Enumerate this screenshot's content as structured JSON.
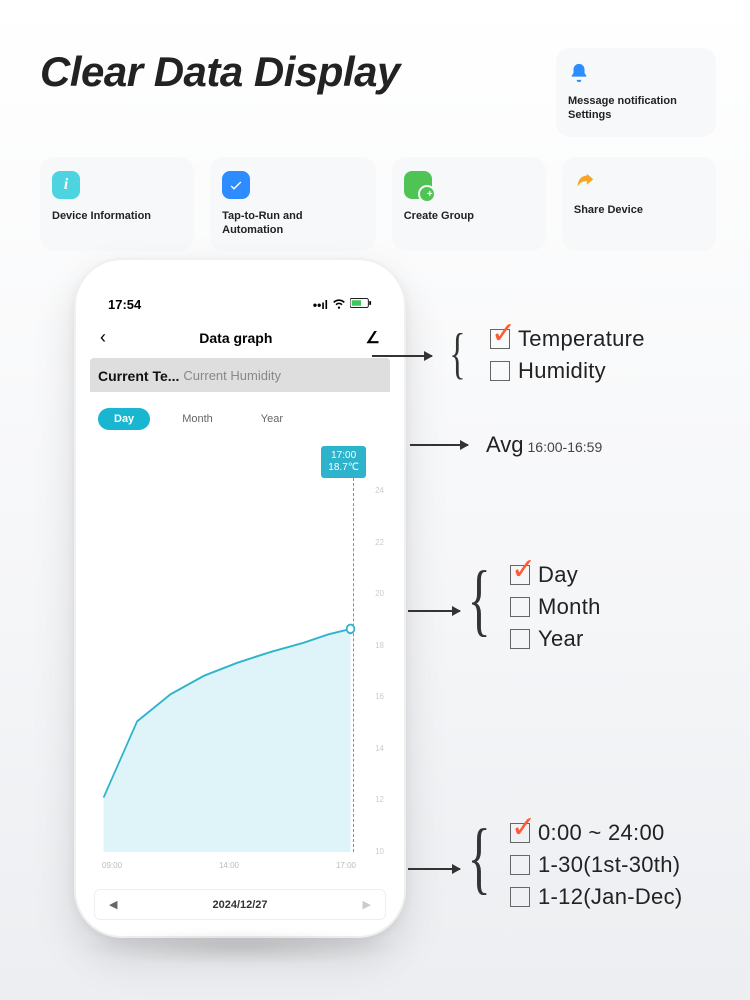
{
  "title": "Clear Data Display",
  "top_card": {
    "label": "Message notification Settings",
    "icon": "bell-icon"
  },
  "cards": [
    {
      "label": "Device Information",
      "icon": "info-icon"
    },
    {
      "label": "Tap-to-Run and Automation",
      "icon": "check-icon"
    },
    {
      "label": "Create Group",
      "icon": "group-icon"
    },
    {
      "label": "Share Device",
      "icon": "share-icon"
    }
  ],
  "phone": {
    "time": "17:54",
    "nav_title": "Data graph",
    "tabs": {
      "active": "Current Te...",
      "inactive": "Current Humidity"
    },
    "segments": [
      "Day",
      "Month",
      "Year"
    ],
    "segment_active": "Day",
    "tooltip_time": "17:00",
    "tooltip_value": "18.7℃",
    "date_nav": "2024/12/27"
  },
  "chart_data": {
    "type": "area",
    "title": "",
    "xlabel": "",
    "ylabel": "",
    "ylim": [
      10,
      24
    ],
    "x_ticks": [
      "09:00",
      "14:00",
      "17:00"
    ],
    "y_ticks": [
      "24",
      "22",
      "20",
      "18",
      "16",
      "14",
      "12",
      "10"
    ],
    "x": [
      "09:00",
      "10:00",
      "11:00",
      "12:00",
      "13:00",
      "14:00",
      "15:00",
      "16:00",
      "17:00"
    ],
    "values": [
      12.5,
      15.0,
      16.0,
      16.8,
      17.3,
      17.7,
      18.1,
      18.5,
      18.7
    ],
    "highlight": {
      "x": "17:00",
      "y": 18.7,
      "label": "18.7℃"
    }
  },
  "annotations": {
    "group1": [
      {
        "label": "Temperature",
        "checked": true
      },
      {
        "label": "Humidity",
        "checked": false
      }
    ],
    "avg": {
      "label": "Avg",
      "sub": "16:00-16:59"
    },
    "group2": [
      {
        "label": "Day",
        "checked": true
      },
      {
        "label": "Month",
        "checked": false
      },
      {
        "label": "Year",
        "checked": false
      }
    ],
    "group3": [
      {
        "label": "0:00 ~ 24:00",
        "checked": true
      },
      {
        "label": "1-30(1st-30th)",
        "checked": false
      },
      {
        "label": "1-12(Jan-Dec)",
        "checked": false
      }
    ]
  }
}
